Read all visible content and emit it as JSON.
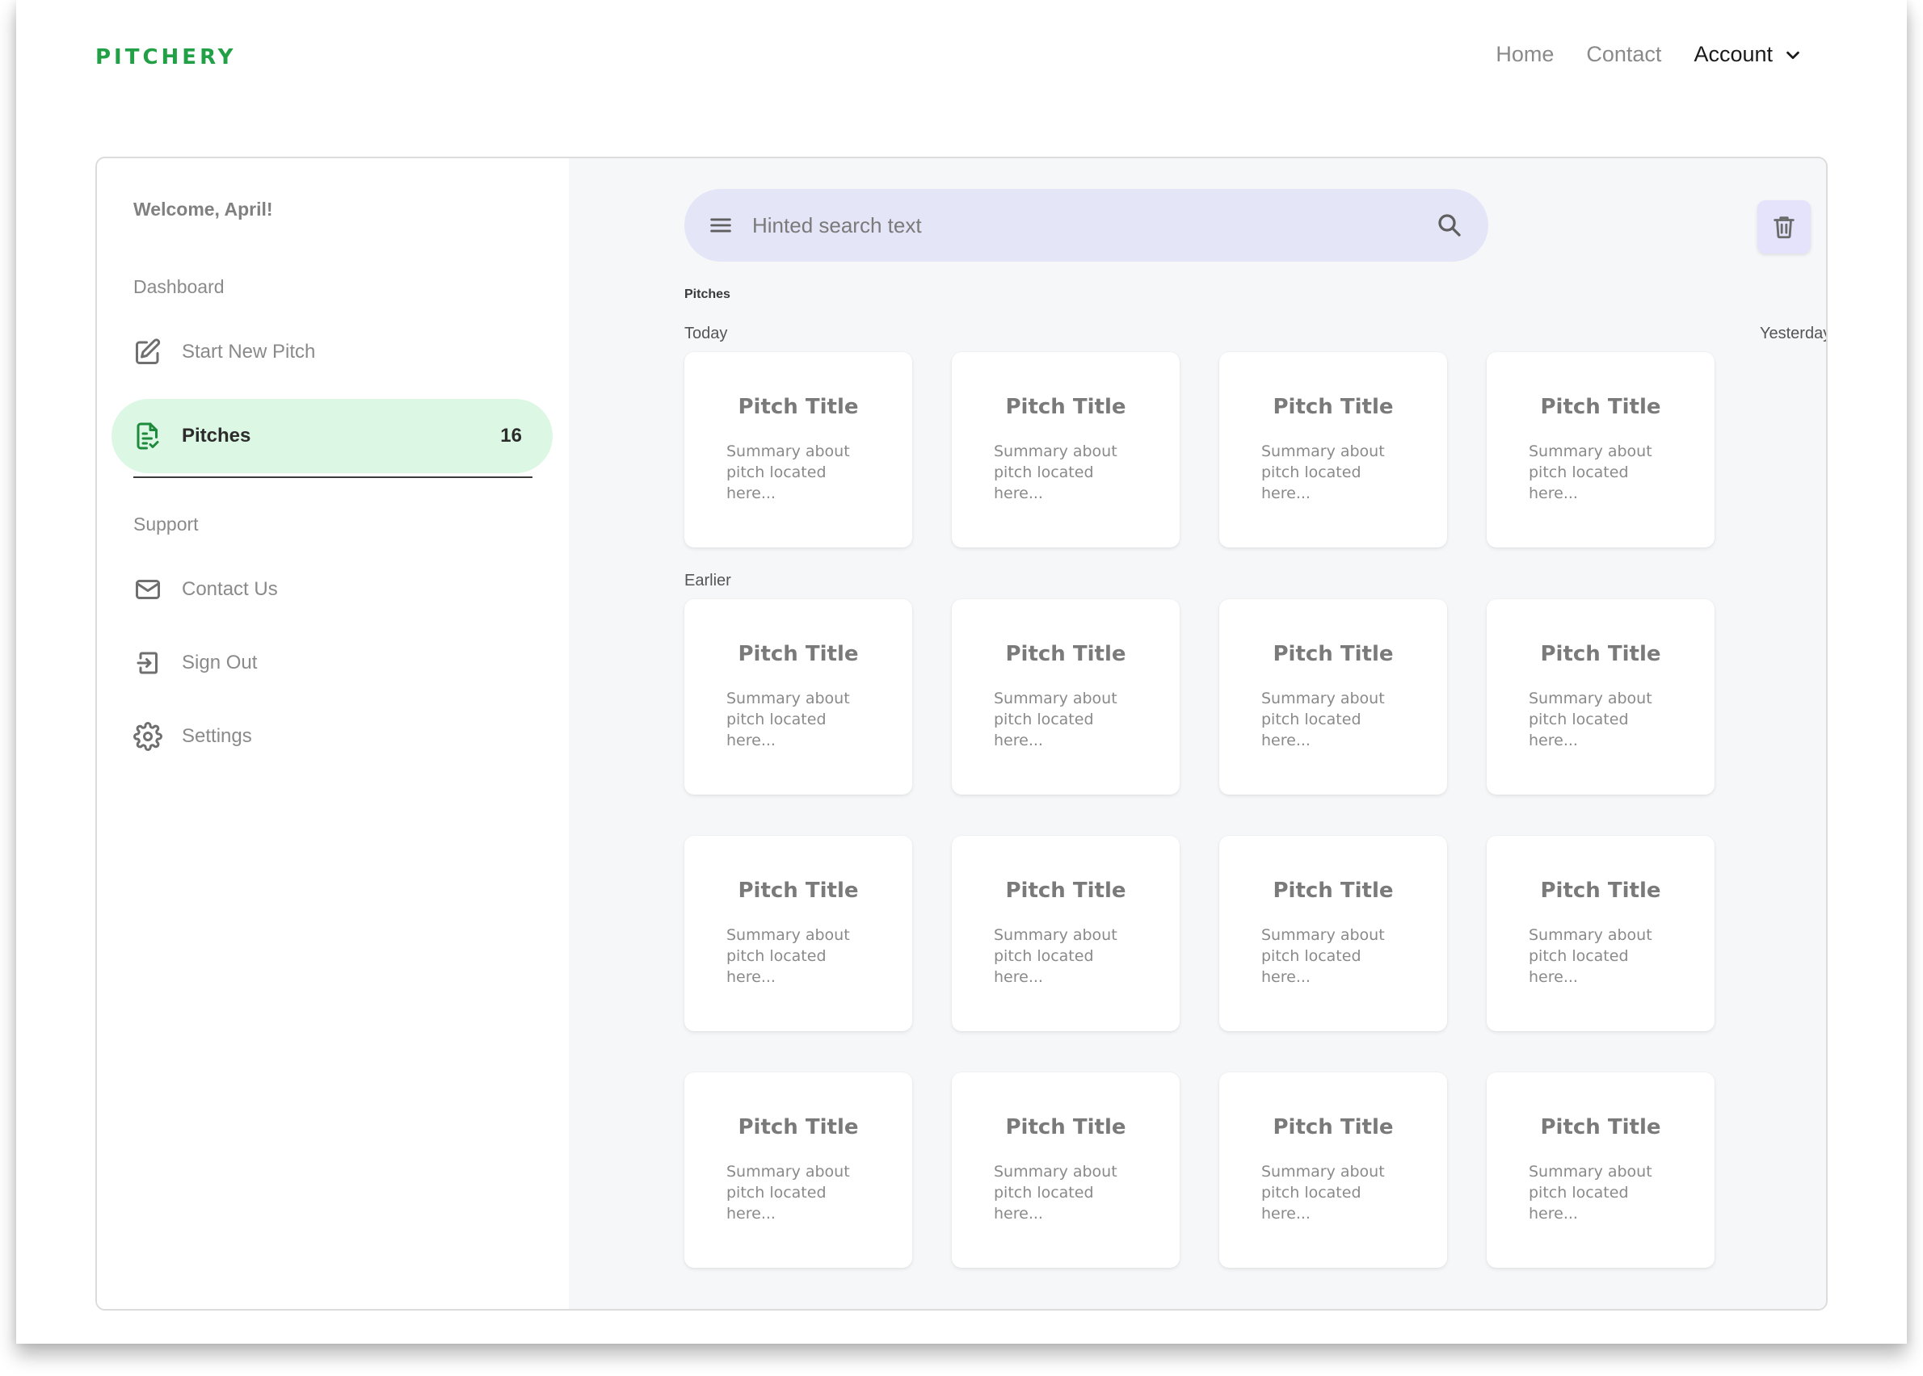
{
  "brand": {
    "name": "PITCHERY",
    "color": "#22a045"
  },
  "topnav": {
    "items": [
      {
        "label": "Home"
      },
      {
        "label": "Contact"
      }
    ],
    "account": {
      "label": "Account",
      "icon": "chevron-down-icon"
    }
  },
  "sidebar": {
    "welcome": "Welcome, April!",
    "sections": {
      "dashboard": "Dashboard",
      "support": "Support"
    },
    "items": [
      {
        "label": "Start New Pitch",
        "icon": "edit-icon"
      },
      {
        "label": "Pitches",
        "icon": "document-check-icon",
        "count": "16",
        "active": true,
        "active_color": "#dcf7e3"
      },
      {
        "label": "Contact Us",
        "icon": "mail-icon"
      },
      {
        "label": "Sign Out",
        "icon": "sign-out-icon"
      },
      {
        "label": "Settings",
        "icon": "gear-icon"
      }
    ]
  },
  "search": {
    "placeholder": "Hinted search text",
    "value": "",
    "menu_icon": "menu-icon",
    "search_icon": "search-icon"
  },
  "toolbar": {
    "delete_icon": "trash-icon"
  },
  "main": {
    "heading": "Pitches",
    "groups": {
      "today": "Today",
      "yesterday": "Yesterday",
      "earlier": "Earlier"
    },
    "cards": [
      {
        "group": "Today",
        "title": "Pitch Title",
        "summary": "Summary about pitch located here..."
      },
      {
        "group": "Today",
        "title": "Pitch Title",
        "summary": "Summary about pitch located here..."
      },
      {
        "group": "Yesterday",
        "title": "Pitch Title",
        "summary": "Summary about pitch located here..."
      },
      {
        "group": "Yesterday",
        "title": "Pitch Title",
        "summary": "Summary about pitch located here..."
      },
      {
        "group": "Earlier",
        "title": "Pitch Title",
        "summary": "Summary about pitch located here..."
      },
      {
        "group": "Earlier",
        "title": "Pitch Title",
        "summary": "Summary about pitch located here..."
      },
      {
        "group": "Earlier",
        "title": "Pitch Title",
        "summary": "Summary about pitch located here..."
      },
      {
        "group": "Earlier",
        "title": "Pitch Title",
        "summary": "Summary about pitch located here..."
      },
      {
        "group": "Earlier",
        "title": "Pitch Title",
        "summary": "Summary about pitch located here..."
      },
      {
        "group": "Earlier",
        "title": "Pitch Title",
        "summary": "Summary about pitch located here..."
      },
      {
        "group": "Earlier",
        "title": "Pitch Title",
        "summary": "Summary about pitch located here..."
      },
      {
        "group": "Earlier",
        "title": "Pitch Title",
        "summary": "Summary about pitch located here..."
      },
      {
        "group": "Earlier",
        "title": "Pitch Title",
        "summary": "Summary about pitch located here..."
      },
      {
        "group": "Earlier",
        "title": "Pitch Title",
        "summary": "Summary about pitch located here..."
      },
      {
        "group": "Earlier",
        "title": "Pitch Title",
        "summary": "Summary about pitch located here..."
      },
      {
        "group": "Earlier",
        "title": "Pitch Title",
        "summary": "Summary about pitch located here..."
      }
    ]
  }
}
